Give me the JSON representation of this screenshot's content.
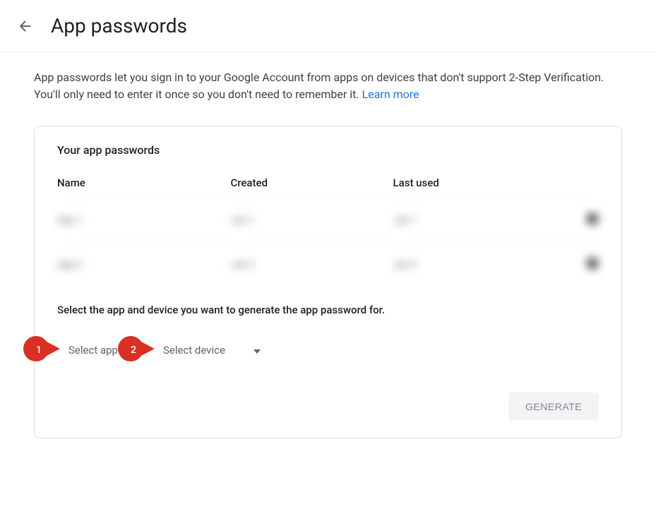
{
  "header": {
    "title": "App passwords"
  },
  "description": {
    "text": "App passwords let you sign in to your Google Account from apps on devices that don't support 2-Step Verification. You'll only need to enter it once so you don't need to remember it. ",
    "learn_more": "Learn more"
  },
  "card": {
    "title": "Your app passwords",
    "columns": {
      "name": "Name",
      "created": "Created",
      "last_used": "Last used"
    },
    "rows": [
      {
        "name": "App 1",
        "created": "Jan 1",
        "last_used": "Jan 1"
      },
      {
        "name": "App 2",
        "created": "Jan 2",
        "last_used": "Jan 2"
      }
    ],
    "instruction": "Select the app and device you want to generate the app password for.",
    "dropdowns": {
      "select_app": "Select app",
      "select_device": "Select device"
    },
    "callouts": {
      "one": "1",
      "two": "2"
    },
    "generate_button": "GENERATE"
  }
}
